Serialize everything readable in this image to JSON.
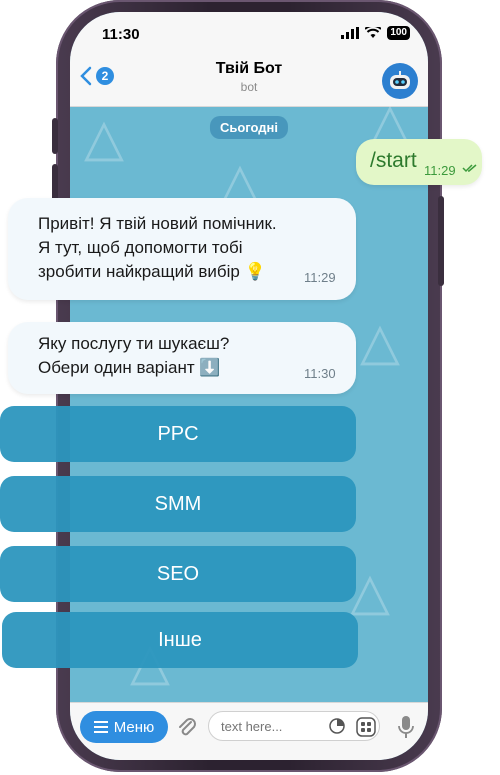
{
  "status": {
    "time": "11:30",
    "battery": "100"
  },
  "header": {
    "back_count": "2",
    "title": "Твій Бот",
    "subtitle": "bot"
  },
  "chat": {
    "date_chip": "Сьогодні",
    "outgoing": {
      "text": "/start",
      "time": "11:29"
    },
    "messages": [
      {
        "lines": [
          "Привіт! Я твій новий помічник.",
          "Я тут, щоб допомогти тобі",
          "зробити найкращий вибір 💡"
        ],
        "time": "11:29"
      },
      {
        "lines": [
          "Яку послугу ти шукаєш?",
          "Обери один варіант ⬇️"
        ],
        "time": "11:30"
      }
    ]
  },
  "keyboard": {
    "buttons": [
      "PPC",
      "SMM",
      "SEO",
      "Інше"
    ]
  },
  "input_bar": {
    "menu_label": "Меню",
    "placeholder": "text here..."
  },
  "colors": {
    "accent": "#2f8ee0",
    "chat_bg": "#6bb9d2",
    "button_bg": "#2c96be",
    "outgoing_bubble": "#e3f7c8"
  }
}
